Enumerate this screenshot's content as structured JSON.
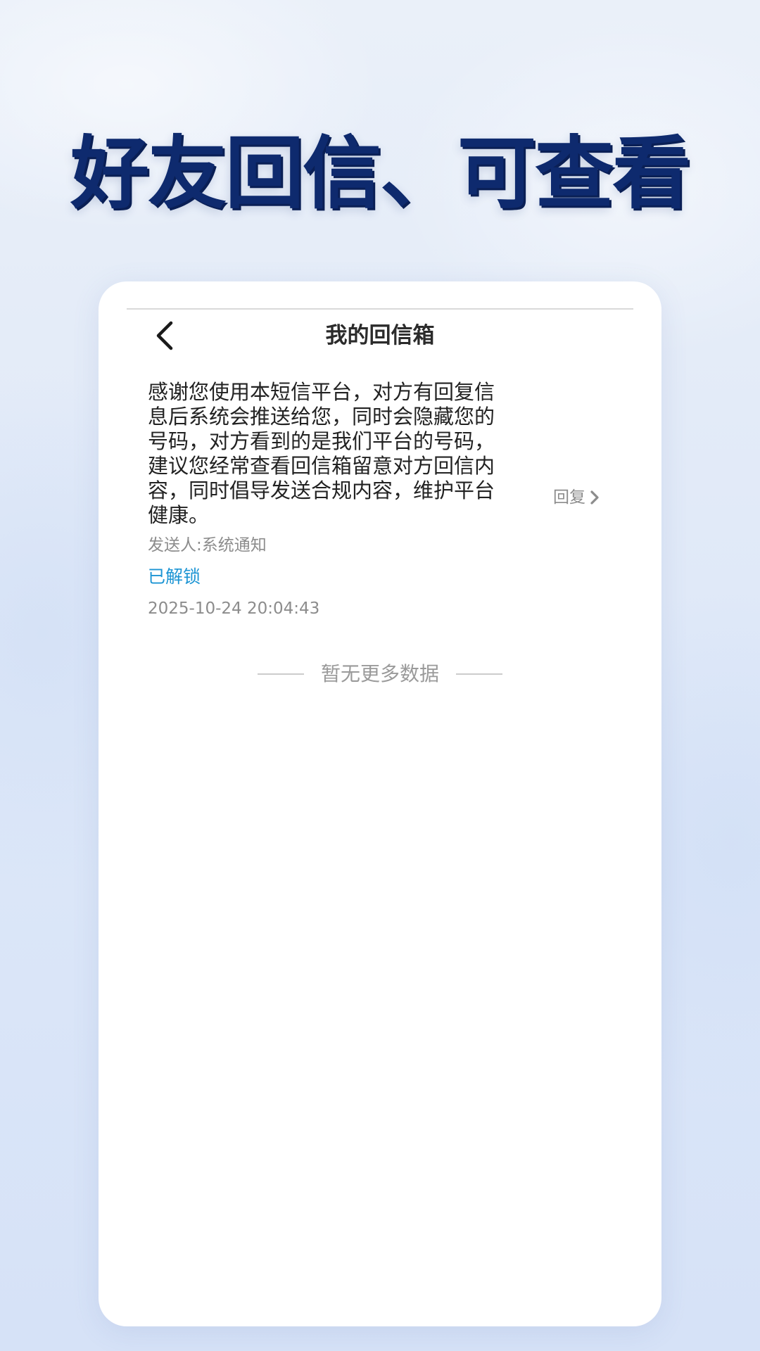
{
  "banner": {
    "headline": "好友回信、可查看"
  },
  "nav": {
    "title": "我的回信箱",
    "back_icon": "chevron-left-icon"
  },
  "messages": [
    {
      "body": "感谢您使用本短信平台，对方有回复信息后系统会推送给您，同时会隐藏您的号码，对方看到的是我们平台的号码，建议您经常查看回信箱留意对方回信内容，同时倡导发送合规内容，维护平台健康。",
      "sender": "发送人:系统通知",
      "status": "已解锁",
      "time": "2025-10-24 20:04:43",
      "reply_label": "回复",
      "reply_icon": "chevron-right-icon"
    }
  ],
  "list": {
    "end_text": "暂无更多数据"
  },
  "colors": {
    "headline": "#0e2a6e",
    "status_unlocked": "#1d95d4",
    "muted_text": "#8c8c8c",
    "card_background": "#ffffff"
  }
}
